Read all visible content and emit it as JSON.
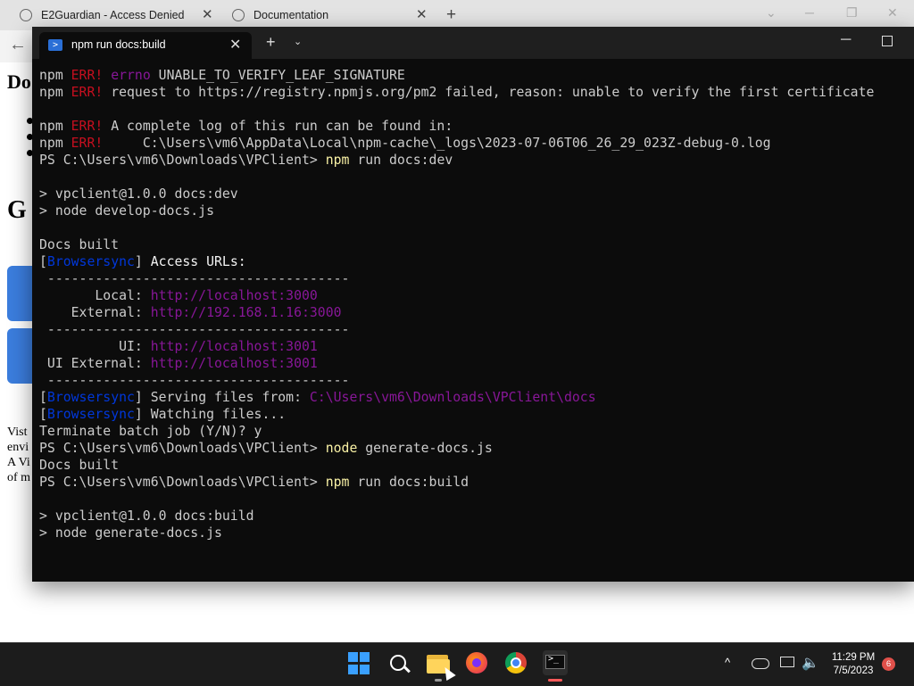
{
  "browser": {
    "tabs": [
      {
        "title": "E2Guardian - Access Denied"
      },
      {
        "title": "Documentation"
      }
    ],
    "new_tab_label": "+",
    "back_icon": "←",
    "doc_peek": {
      "heading": "Do",
      "heading2": "G",
      "para": "Vist\nenvi\nA Vi\nof m"
    }
  },
  "terminal": {
    "tab_title": "npm run docs:build",
    "close_label": "✕",
    "new_tab_label": "+",
    "dropdown_label": "⌄",
    "lines": [
      [
        {
          "t": "npm "
        },
        {
          "t": "ERR!",
          "c": "red"
        },
        {
          "t": " "
        },
        {
          "t": "errno",
          "c": "magenta"
        },
        {
          "t": " UNABLE_TO_VERIFY_LEAF_SIGNATURE"
        }
      ],
      [
        {
          "t": "npm "
        },
        {
          "t": "ERR!",
          "c": "red"
        },
        {
          "t": " request to https://registry.npmjs.org/pm2 failed, reason: unable to verify the first certificate"
        }
      ],
      [],
      [
        {
          "t": "npm "
        },
        {
          "t": "ERR!",
          "c": "red"
        },
        {
          "t": " A complete log of this run can be found in:"
        }
      ],
      [
        {
          "t": "npm "
        },
        {
          "t": "ERR!",
          "c": "red"
        },
        {
          "t": "     C:\\Users\\vm6\\AppData\\Local\\npm-cache\\_logs\\2023-07-06T06_26_29_023Z-debug-0.log"
        }
      ],
      [
        {
          "t": "PS C:\\Users\\vm6\\Downloads\\VPClient> "
        },
        {
          "t": "npm",
          "c": "yellow"
        },
        {
          "t": " run docs:dev"
        }
      ],
      [],
      [
        {
          "t": "> vpclient@1.0.0 docs:dev"
        }
      ],
      [
        {
          "t": "> node develop-docs.js"
        }
      ],
      [],
      [
        {
          "t": "Docs built"
        }
      ],
      [
        {
          "t": "["
        },
        {
          "t": "Browsersync",
          "c": "blue"
        },
        {
          "t": "] "
        },
        {
          "t": "Access URLs:",
          "c": "white"
        }
      ],
      [
        {
          "t": " --------------------------------------"
        }
      ],
      [
        {
          "t": "       Local: "
        },
        {
          "t": "http://localhost:3000",
          "c": "magenta"
        }
      ],
      [
        {
          "t": "    External: "
        },
        {
          "t": "http://192.168.1.16:3000",
          "c": "magenta"
        }
      ],
      [
        {
          "t": " --------------------------------------"
        }
      ],
      [
        {
          "t": "          UI: "
        },
        {
          "t": "http://localhost:3001",
          "c": "magenta"
        }
      ],
      [
        {
          "t": " UI External: "
        },
        {
          "t": "http://localhost:3001",
          "c": "magenta"
        }
      ],
      [
        {
          "t": " --------------------------------------"
        }
      ],
      [
        {
          "t": "["
        },
        {
          "t": "Browsersync",
          "c": "blue"
        },
        {
          "t": "] Serving files from: "
        },
        {
          "t": "C:\\Users\\vm6\\Downloads\\VPClient\\docs",
          "c": "magenta"
        }
      ],
      [
        {
          "t": "["
        },
        {
          "t": "Browsersync",
          "c": "blue"
        },
        {
          "t": "] Watching files..."
        }
      ],
      [
        {
          "t": "Terminate batch job (Y/N)? y"
        }
      ],
      [
        {
          "t": "PS C:\\Users\\vm6\\Downloads\\VPClient> "
        },
        {
          "t": "node",
          "c": "yellow"
        },
        {
          "t": " generate-docs.js"
        }
      ],
      [
        {
          "t": "Docs built"
        }
      ],
      [
        {
          "t": "PS C:\\Users\\vm6\\Downloads\\VPClient> "
        },
        {
          "t": "npm",
          "c": "yellow"
        },
        {
          "t": " run docs:build"
        }
      ],
      [],
      [
        {
          "t": "> vpclient@1.0.0 docs:build"
        }
      ],
      [
        {
          "t": "> node generate-docs.js"
        }
      ]
    ]
  },
  "colors": {
    "terminal_bg": "#0c0c0c",
    "err_red": "#c50f1f",
    "magenta": "#881798",
    "browsersync_blue": "#0037da",
    "command_yellow": "#f9f1a5"
  },
  "taskbar": {
    "apps": [
      "windows-start-icon",
      "search-icon",
      "file-explorer-icon",
      "firefox-icon",
      "chrome-icon",
      "terminal-icon"
    ],
    "tray_chevron": "^",
    "time": "11:29 PM",
    "date": "7/5/2023",
    "notification_count": "6"
  }
}
